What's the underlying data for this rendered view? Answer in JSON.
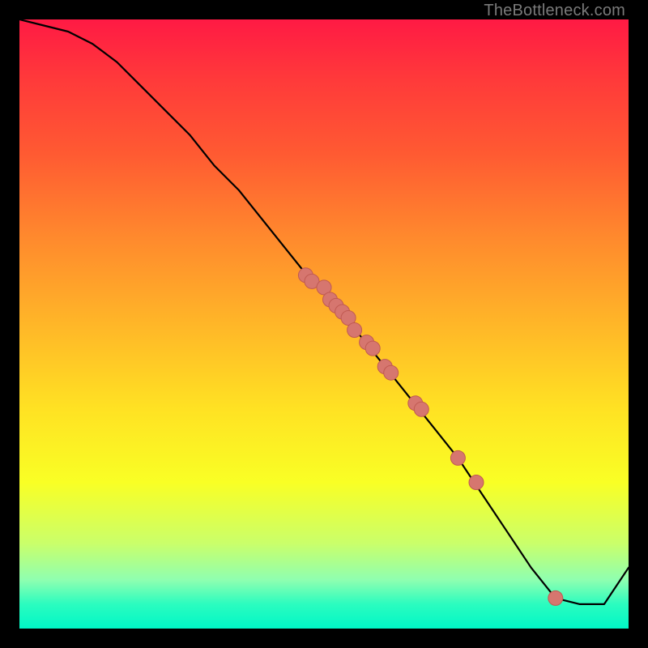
{
  "watermark": "TheBottleneck.com",
  "colors": {
    "curve": "#000000",
    "marker_fill": "#d6766f",
    "marker_stroke": "#c05a52",
    "background": "#000000"
  },
  "chart_data": {
    "type": "line",
    "title": "",
    "xlabel": "",
    "ylabel": "",
    "xlim": [
      0,
      100
    ],
    "ylim": [
      0,
      100
    ],
    "grid": false,
    "legend": false,
    "series": [
      {
        "name": "curve",
        "x": [
          0,
          4,
          8,
          12,
          16,
          20,
          24,
          28,
          32,
          36,
          40,
          44,
          48,
          52,
          56,
          60,
          64,
          68,
          72,
          76,
          80,
          84,
          88,
          92,
          96,
          100
        ],
        "y": [
          100,
          99,
          98,
          96,
          93,
          89,
          85,
          81,
          76,
          72,
          67,
          62,
          57,
          53,
          48,
          43,
          38,
          33,
          28,
          22,
          16,
          10,
          5,
          4,
          4,
          10
        ]
      }
    ],
    "markers": {
      "name": "points",
      "x": [
        47,
        48,
        50,
        51,
        52,
        53,
        54,
        55,
        57,
        58,
        60,
        61,
        65,
        66,
        72,
        75,
        88
      ],
      "y": [
        58,
        57,
        56,
        54,
        53,
        52,
        51,
        49,
        47,
        46,
        43,
        42,
        37,
        36,
        28,
        24,
        5
      ]
    }
  }
}
